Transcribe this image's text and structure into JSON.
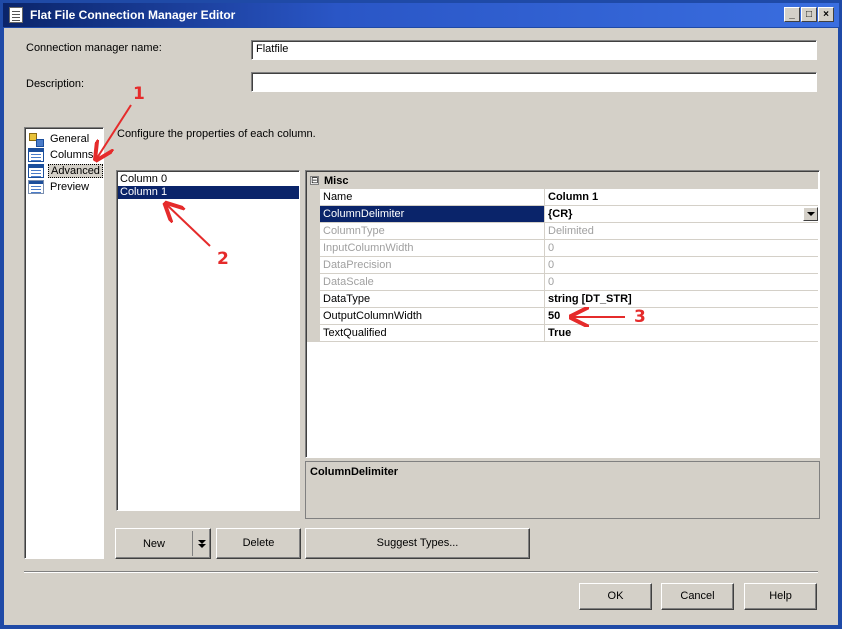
{
  "window": {
    "title": "Flat File Connection Manager Editor",
    "minimize": "_",
    "maximize": "□",
    "close": "×"
  },
  "form": {
    "connection_name_label": "Connection manager name:",
    "connection_name_value": "Flatfile",
    "description_label": "Description:",
    "description_value": ""
  },
  "nav": {
    "items": [
      {
        "label": "General",
        "icon": "general-icon"
      },
      {
        "label": "Columns",
        "icon": "columns-icon"
      },
      {
        "label": "Advanced",
        "icon": "advanced-icon",
        "selected": true
      },
      {
        "label": "Preview",
        "icon": "preview-icon"
      }
    ]
  },
  "main": {
    "instruction": "Configure the properties of each column."
  },
  "column_list": {
    "items": [
      "Column 0",
      "Column 1"
    ],
    "selected_index": 1
  },
  "property_grid": {
    "category": "Misc",
    "category_toggle": "⊟",
    "rows": [
      {
        "name": "Name",
        "value": "Column 1",
        "state": "bold"
      },
      {
        "name": "ColumnDelimiter",
        "value": "{CR}",
        "state": "selected"
      },
      {
        "name": "ColumnType",
        "value": "Delimited",
        "state": "disabled"
      },
      {
        "name": "InputColumnWidth",
        "value": "0",
        "state": "disabled"
      },
      {
        "name": "DataPrecision",
        "value": "0",
        "state": "disabled"
      },
      {
        "name": "DataScale",
        "value": "0",
        "state": "disabled"
      },
      {
        "name": "DataType",
        "value": "string [DT_STR]",
        "state": "bold"
      },
      {
        "name": "OutputColumnWidth",
        "value": "50",
        "state": "bold"
      },
      {
        "name": "TextQualified",
        "value": "True",
        "state": "bold"
      }
    ]
  },
  "description_box": {
    "title": "ColumnDelimiter"
  },
  "buttons": {
    "new": "New",
    "delete": "Delete",
    "suggest_types": "Suggest Types...",
    "ok": "OK",
    "cancel": "Cancel",
    "help": "Help"
  },
  "annotations": {
    "one": "1",
    "two": "2",
    "three": "3",
    "color": "#e52b2b"
  },
  "colors": {
    "titlebar": "#0a246a",
    "selection": "#0a246a",
    "dialog_face": "#d4d0c8"
  }
}
